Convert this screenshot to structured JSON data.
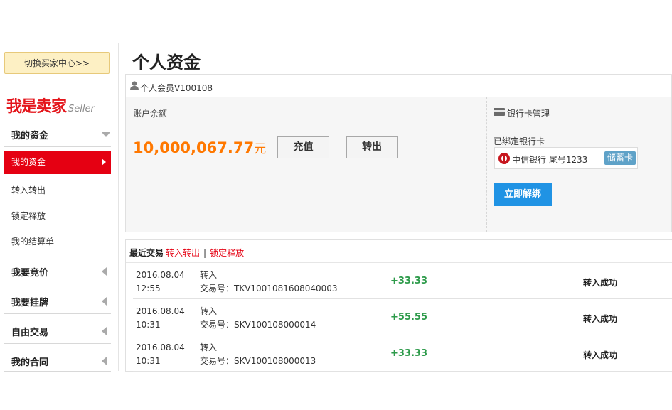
{
  "sidebar": {
    "switch_button": "切换买家中心>>",
    "seller_cn": "我是卖家",
    "seller_en": "Seller",
    "sections": [
      {
        "label": "我的资金",
        "expanded": true
      },
      {
        "label": "我要竞价"
      },
      {
        "label": "我要挂牌"
      },
      {
        "label": "自由交易"
      },
      {
        "label": "我的合同"
      }
    ],
    "sub_items": [
      "我的资金",
      "转入转出",
      "锁定释放",
      "我的结算单"
    ]
  },
  "page_title": "个人资金",
  "account": {
    "member": "个人会员V100108",
    "balance_label": "账户余额",
    "balance": "10,000,067.77",
    "unit": "元",
    "recharge_label": "充值",
    "transfer_out_label": "转出"
  },
  "bank": {
    "title": "银行卡管理",
    "bound_label": "已绑定银行卡",
    "card_text": "中信银行 尾号1233",
    "card_type": "储蓄卡",
    "unbind_label": "立即解绑"
  },
  "recent": {
    "title": "最近交易",
    "link1": "转入转出",
    "separator": "|",
    "link2": "锁定释放",
    "rows": [
      {
        "date": "2016.08.04",
        "time": "12:55",
        "type": "转入",
        "tx_no": "交易号：TKV1001081608040003",
        "amount": "+33.33",
        "status": "转入成功"
      },
      {
        "date": "2016.08.04",
        "time": "10:31",
        "type": "转入",
        "tx_no": "交易号：SKV100108000014",
        "amount": "+55.55",
        "status": "转入成功"
      },
      {
        "date": "2016.08.04",
        "time": "10:31",
        "type": "转入",
        "tx_no": "交易号：SKV100108000013",
        "amount": "+33.33",
        "status": "转入成功"
      }
    ]
  },
  "colors": {
    "accent_red": "#e50012",
    "balance_orange": "#ff7800",
    "positive_green": "#2e9b4b",
    "unbind_blue": "#2093e4"
  }
}
